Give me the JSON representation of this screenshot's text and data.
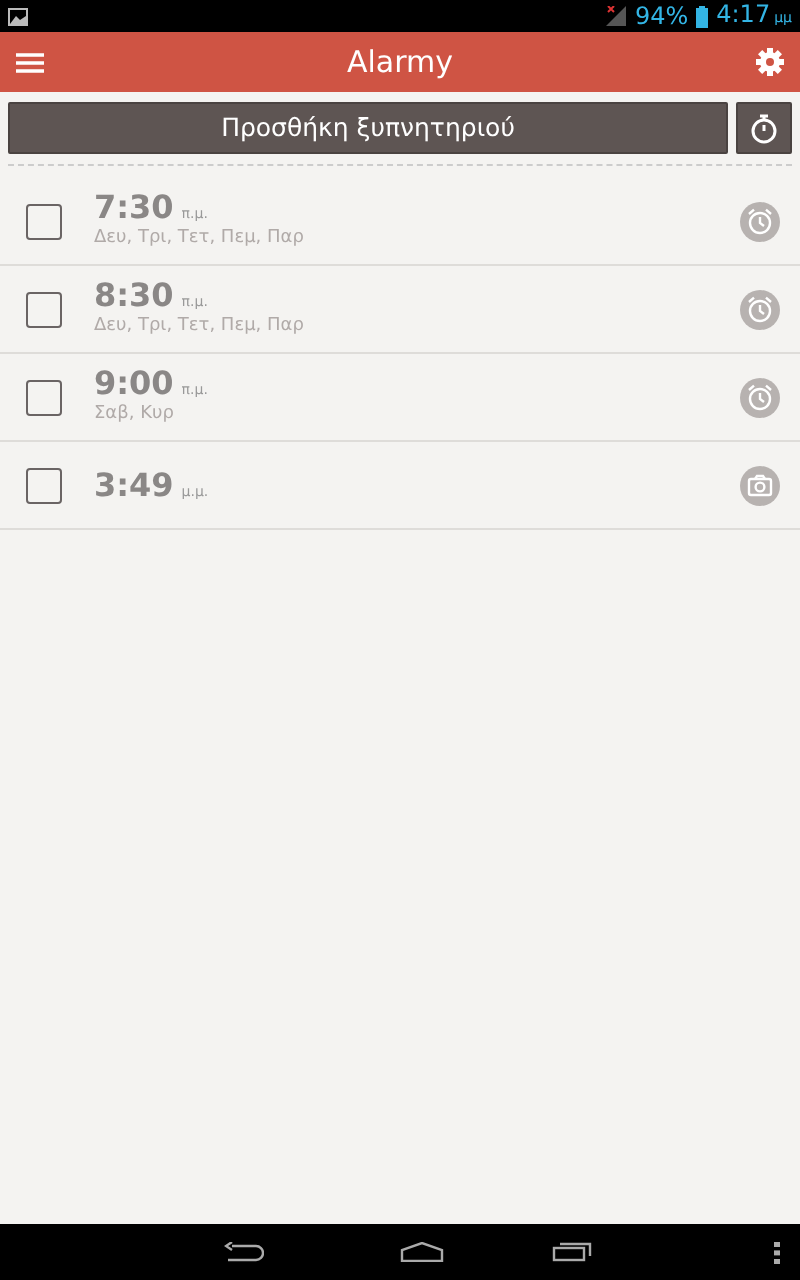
{
  "status_bar": {
    "battery": "94%",
    "time": "4:17",
    "time_suffix": "μμ"
  },
  "app_bar": {
    "title": "Alarmy"
  },
  "add_button": {
    "label": "Προσθήκη ξυπνητηριού"
  },
  "alarms": [
    {
      "time": "7:30",
      "period": "π.μ.",
      "days": "Δευ, Τρι, Τετ, Πεμ, Παρ",
      "checked": false,
      "kind": "alarm"
    },
    {
      "time": "8:30",
      "period": "π.μ.",
      "days": "Δευ, Τρι, Τετ, Πεμ, Παρ",
      "checked": false,
      "kind": "alarm"
    },
    {
      "time": "9:00",
      "period": "π.μ.",
      "days": "Σαβ, Κυρ",
      "checked": false,
      "kind": "alarm"
    },
    {
      "time": "3:49",
      "period": "μ.μ.",
      "checked": false,
      "kind": "camera"
    }
  ]
}
